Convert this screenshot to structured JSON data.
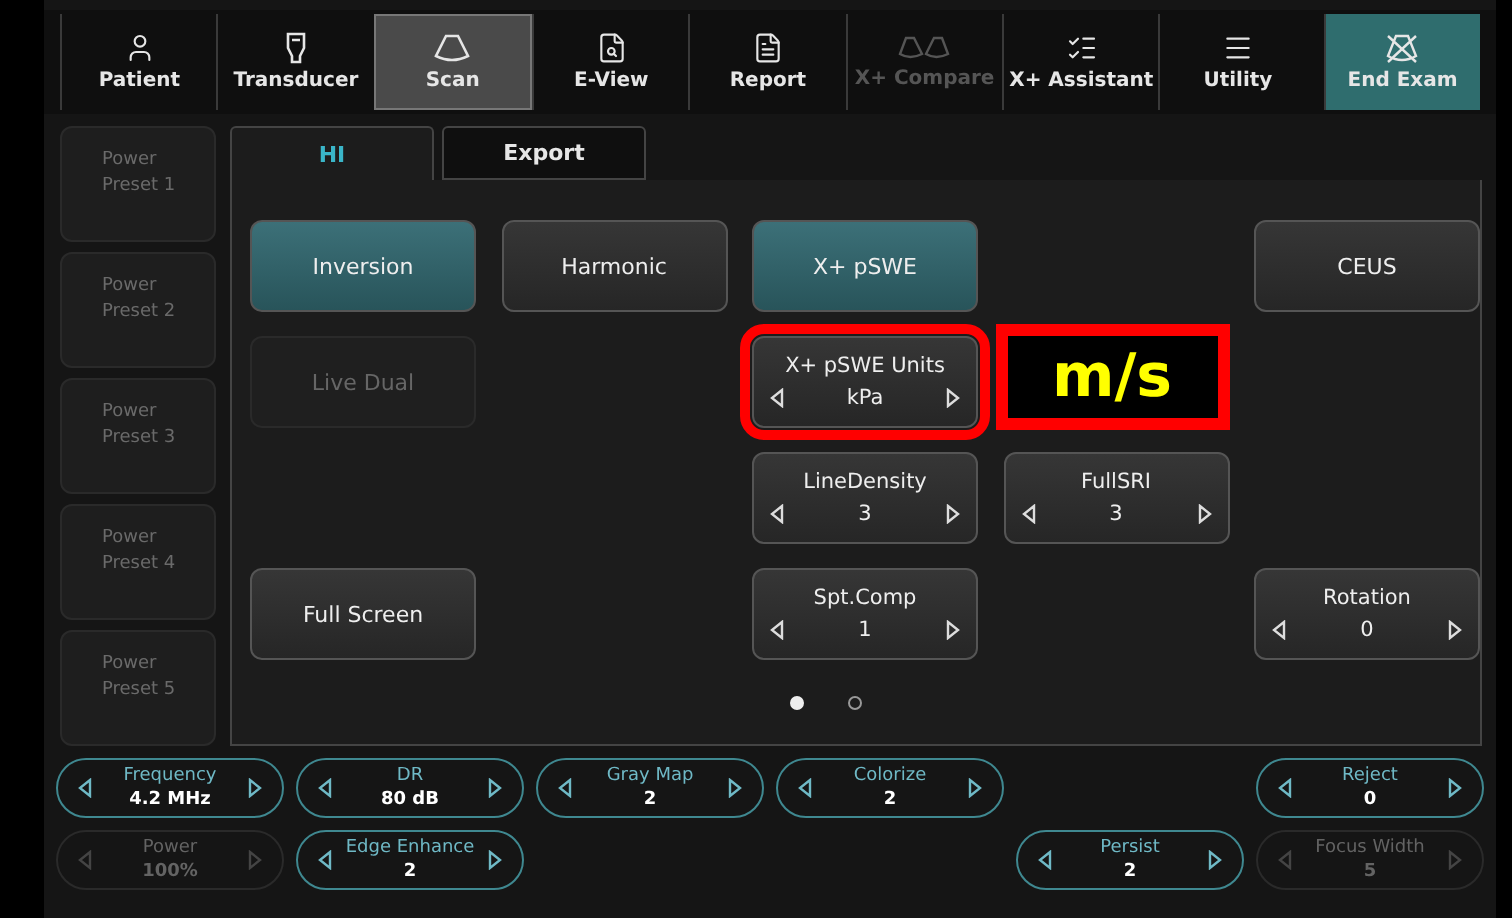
{
  "toolbar": [
    {
      "label": "Patient",
      "selected": false,
      "disabled": false,
      "kind": "tab"
    },
    {
      "label": "Transducer",
      "selected": false,
      "disabled": false,
      "kind": "tab"
    },
    {
      "label": "Scan",
      "selected": true,
      "disabled": false,
      "kind": "tab"
    },
    {
      "label": "E-View",
      "selected": false,
      "disabled": false,
      "kind": "tab"
    },
    {
      "label": "Report",
      "selected": false,
      "disabled": false,
      "kind": "tab"
    },
    {
      "label": "X+ Compare",
      "selected": false,
      "disabled": true,
      "kind": "tab"
    },
    {
      "label": "X+ Assistant",
      "selected": false,
      "disabled": false,
      "kind": "tab"
    },
    {
      "label": "Utility",
      "selected": false,
      "disabled": false,
      "kind": "tab"
    },
    {
      "label": "End Exam",
      "selected": false,
      "disabled": false,
      "kind": "end"
    }
  ],
  "presets": [
    {
      "label": "Power Preset 1",
      "disabled": true
    },
    {
      "label": "Power Preset 2",
      "disabled": true
    },
    {
      "label": "Power Preset 3",
      "disabled": true
    },
    {
      "label": "Power Preset 4",
      "disabled": true
    },
    {
      "label": "Power Preset 5",
      "disabled": true
    }
  ],
  "tabs": [
    {
      "label": "HI",
      "selected": true
    },
    {
      "label": "Export",
      "selected": false
    }
  ],
  "grid_rows": [
    {
      "cells": [
        {
          "kind": "toggle",
          "label": "Inversion",
          "on": true,
          "disabled": false
        },
        {
          "kind": "toggle",
          "label": "Harmonic",
          "on": false,
          "disabled": false
        },
        {
          "kind": "toggle",
          "label": "X+ pSWE",
          "on": true,
          "disabled": false
        },
        {
          "kind": "blank"
        },
        {
          "kind": "toggle",
          "label": "CEUS",
          "on": false,
          "disabled": false
        }
      ]
    },
    {
      "cells": [
        {
          "kind": "toggle",
          "label": "Live Dual",
          "on": false,
          "disabled": true
        },
        {
          "kind": "blank"
        },
        {
          "kind": "stepper",
          "label": "X+ pSWE Units",
          "value": "kPa",
          "highlighted": true
        },
        {
          "kind": "note",
          "text": "m/s"
        },
        {
          "kind": "blank"
        }
      ]
    },
    {
      "cells": [
        {
          "kind": "blank"
        },
        {
          "kind": "blank"
        },
        {
          "kind": "stepper",
          "label": "LineDensity",
          "value": "3",
          "highlighted": false
        },
        {
          "kind": "stepper",
          "label": "FullSRI",
          "value": "3",
          "highlighted": false
        },
        {
          "kind": "blank"
        }
      ]
    },
    {
      "cells": [
        {
          "kind": "toggle",
          "label": "Full Screen",
          "on": false,
          "disabled": false
        },
        {
          "kind": "blank"
        },
        {
          "kind": "stepper",
          "label": "Spt.Comp",
          "value": "1",
          "highlighted": false
        },
        {
          "kind": "blank"
        },
        {
          "kind": "stepper",
          "label": "Rotation",
          "value": "0",
          "highlighted": false
        }
      ]
    }
  ],
  "pages": [
    {
      "selected": true
    },
    {
      "selected": false
    }
  ],
  "knob_rows": [
    {
      "knobs": [
        {
          "kind": "knob",
          "label": "Frequency",
          "value": "4.2 MHz",
          "disabled": false
        },
        {
          "kind": "knob",
          "label": "DR",
          "value": "80 dB",
          "disabled": false
        },
        {
          "kind": "knob",
          "label": "Gray Map",
          "value": "2",
          "disabled": false
        },
        {
          "kind": "knob",
          "label": "Colorize",
          "value": "2",
          "disabled": false
        },
        {
          "kind": "blank"
        },
        {
          "kind": "knob",
          "label": "Reject",
          "value": "0",
          "disabled": false
        }
      ]
    },
    {
      "knobs": [
        {
          "kind": "knob",
          "label": "Power",
          "value": "100%",
          "disabled": true
        },
        {
          "kind": "knob",
          "label": "Edge Enhance",
          "value": "2",
          "disabled": false
        },
        {
          "kind": "blank"
        },
        {
          "kind": "blank"
        },
        {
          "kind": "knob",
          "label": "Persist",
          "value": "2",
          "disabled": false
        },
        {
          "kind": "knob",
          "label": "Focus Width",
          "value": "5",
          "disabled": true
        }
      ]
    }
  ]
}
